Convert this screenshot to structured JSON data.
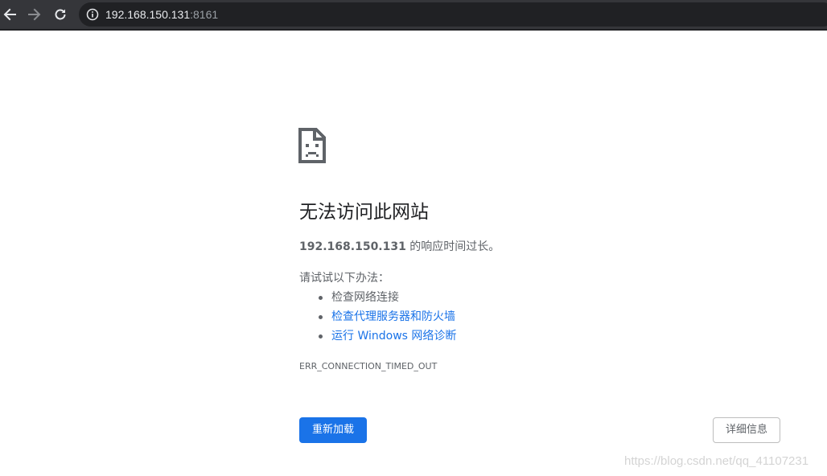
{
  "browser": {
    "url_host": "192.168.150.131",
    "url_port": ":8161",
    "icons": {
      "back": "back-arrow-icon",
      "forward": "forward-arrow-icon",
      "reload": "reload-icon",
      "site_info": "info-icon"
    }
  },
  "error_page": {
    "title": "无法访问此网站",
    "summary_host": "192.168.150.131",
    "summary_text": " 的响应时间过长。",
    "try_label": "请试试以下办法：",
    "suggestions": [
      {
        "label": "检查网络连接",
        "is_link": false
      },
      {
        "label": "检查代理服务器和防火墙",
        "is_link": true
      },
      {
        "label": "运行 Windows 网络诊断",
        "is_link": true
      }
    ],
    "error_code": "ERR_CONNECTION_TIMED_OUT",
    "reload_button": "重新加载",
    "details_button": "详细信息"
  },
  "watermark": "https://blog.csdn.net/qq_41107231",
  "colors": {
    "toolbar": "#35363a",
    "omnibox": "#202124",
    "link": "#1a73e8",
    "primary_button": "#1a73e8",
    "body_text": "#5f6368",
    "title_text": "#202124"
  }
}
